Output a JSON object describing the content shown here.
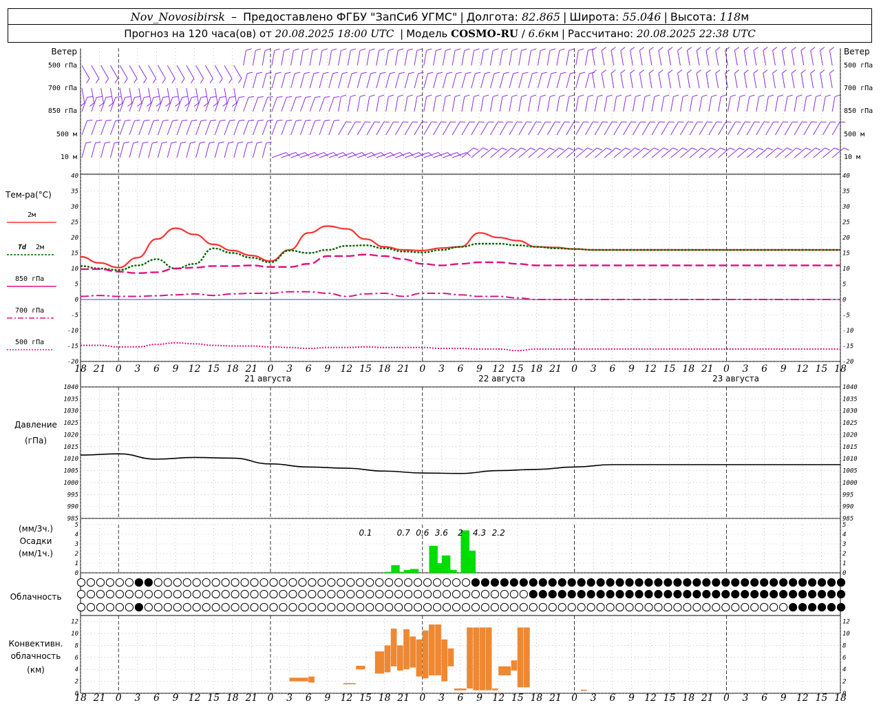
{
  "header": {
    "station": "Nov_Novosibirsk",
    "provider": "Предоставлено ФГБУ \"ЗапСиб УГМС\"",
    "lon_label": "Долгота:",
    "lon_value": "82.865",
    "lat_label": "Широта:",
    "lat_value": "55.046",
    "alt_label": "Высота:",
    "alt_value": "118",
    "alt_unit": "м",
    "forecast_pre": "Прогноз на 120 часа(ов) от",
    "forecast_time": "20.08.2025 18:00 UTC",
    "model_label": "Модель",
    "model_name": "COSMO-RU",
    "model_res": "6.6",
    "model_res_unit": "км",
    "calc_label": "Рассчитано:",
    "calc_time": "20.08.2025 22:38 UTC"
  },
  "labels": {
    "wind": "Ветер",
    "wind_levels": [
      "500 гПа",
      "700 гПа",
      "850 гПа",
      "500 м",
      "10 м"
    ],
    "temp_title": "Тем-ра(°C)",
    "temp_2m": "2м",
    "td": "Td",
    "td_2m": "2м",
    "t850": "850 гПа",
    "t700": "700 гПа",
    "t500": "500 гПа",
    "pressure1": "Давление",
    "pressure2": "(гПа)",
    "precip1": "(мм/3ч.)",
    "precip2": "Осадки",
    "precip3": "(мм/1ч.)",
    "cloud": "Облачность",
    "conv1": "Конвективн.",
    "conv2": "облачность",
    "conv3": "(км)",
    "dates": [
      "21 августа",
      "22 августа",
      "23 августа"
    ]
  },
  "colors": {
    "wind": "#8a2be2",
    "t2m": "#ff3030",
    "td": "#006400",
    "levels": "#e0117f",
    "zero": "#0000cc",
    "pressure": "#000000",
    "precip": "#00dd00",
    "conv": "#ee8833"
  },
  "chart_data": [
    {
      "type": "line",
      "name": "temperature",
      "x_hours": [
        0,
        3,
        6,
        9,
        12,
        15,
        18,
        21,
        24,
        27,
        30,
        33,
        36,
        39,
        42,
        45,
        48,
        51,
        54,
        57,
        60,
        63,
        66,
        69,
        72,
        75,
        78,
        81,
        84,
        87,
        90,
        93,
        96,
        99,
        102,
        105,
        108,
        111,
        114,
        117,
        120
      ],
      "x_tick_labels": [
        "18",
        "21",
        "0",
        "3",
        "6",
        "9",
        "12",
        "15",
        "18",
        "21",
        "0",
        "3",
        "6",
        "9",
        "12",
        "15",
        "18",
        "21",
        "0",
        "3",
        "6",
        "9",
        "12",
        "15",
        "18",
        "21",
        "0",
        "3",
        "6",
        "9",
        "12",
        "15",
        "18",
        "21",
        "0",
        "3",
        "6",
        "9",
        "12",
        "15",
        "18",
        "21",
        "0"
      ],
      "ylim": [
        -20,
        40
      ],
      "y_ticks": [
        40,
        35,
        30,
        25,
        20,
        15,
        10,
        5,
        0,
        -5,
        -10,
        -15,
        -20
      ],
      "series": [
        {
          "name": "2м",
          "values": [
            13.8,
            11.8,
            10.3,
            13.5,
            19.5,
            23.0,
            21.0,
            17.8,
            15.8,
            14.2,
            12.4,
            16.0,
            21.5,
            23.7,
            22.8,
            19.5,
            17.0,
            16.0,
            15.8,
            16.6,
            17.0,
            21.5,
            20.0,
            19.0,
            17.0,
            16.8,
            16.3,
            16.0,
            16.0,
            16.0,
            16.0,
            16.0,
            16.0,
            16.0,
            16.0,
            16.0,
            16.0,
            16.0,
            16.0,
            16.0,
            16.0
          ]
        },
        {
          "name": "Td 2м",
          "values": [
            10.8,
            10.0,
            9.5,
            11.0,
            13.0,
            10.0,
            11.5,
            16.5,
            15.0,
            13.5,
            12.0,
            15.8,
            15.0,
            16.0,
            17.3,
            17.5,
            16.5,
            15.5,
            15.2,
            16.0,
            17.0,
            18.0,
            18.0,
            17.5,
            17.0,
            16.5,
            16.3,
            16.0,
            16.0,
            16.0,
            16.0,
            16.0,
            16.0,
            16.0,
            16.0,
            16.0,
            16.0,
            16.0,
            16.0,
            16.0,
            16.0
          ]
        },
        {
          "name": "850 гПа",
          "values": [
            9.8,
            9.8,
            9.0,
            8.5,
            8.8,
            10.0,
            10.3,
            10.8,
            10.8,
            11.0,
            10.5,
            10.5,
            11.5,
            14.0,
            14.0,
            14.5,
            14.0,
            13.0,
            11.5,
            11.0,
            11.5,
            12.0,
            12.0,
            11.5,
            11.0,
            11.0,
            11.0,
            11.0,
            11.0,
            11.0,
            11.0,
            11.0,
            11.0,
            11.0,
            11.0,
            11.0,
            11.0,
            11.0,
            11.0,
            11.0,
            11.0
          ]
        },
        {
          "name": "700 гПа",
          "values": [
            1.0,
            1.3,
            1.0,
            1.0,
            1.2,
            1.5,
            1.8,
            1.3,
            1.8,
            2.0,
            2.0,
            2.5,
            2.5,
            2.0,
            1.0,
            1.8,
            2.0,
            1.0,
            2.0,
            2.0,
            1.5,
            1.0,
            1.0,
            0.5,
            0.0,
            0.0,
            0.0,
            0.0,
            0.0,
            0.0,
            0.0,
            0.0,
            0.0,
            0.0,
            0.0,
            0.0,
            0.0,
            0.0,
            0.0,
            0.0,
            0.0
          ]
        },
        {
          "name": "500 гПа",
          "values": [
            -14.8,
            -14.8,
            -15.3,
            -15.3,
            -14.5,
            -14.0,
            -14.3,
            -14.8,
            -15.0,
            -15.0,
            -15.3,
            -15.5,
            -15.8,
            -15.5,
            -15.5,
            -15.3,
            -15.5,
            -15.5,
            -15.5,
            -15.8,
            -15.8,
            -16.0,
            -16.0,
            -16.5,
            -16.0,
            -16.0,
            -16.0,
            -16.0,
            -16.0,
            -16.0,
            -16.0,
            -16.0,
            -16.0,
            -16.0,
            -16.0,
            -16.0,
            -16.0,
            -16.0,
            -16.0,
            -16.0,
            -16.0
          ]
        }
      ]
    },
    {
      "type": "line",
      "name": "pressure",
      "x_hours": [
        0,
        6,
        12,
        18,
        24,
        30,
        36,
        42,
        48,
        54,
        60,
        66,
        72,
        78,
        84,
        90,
        96,
        102,
        108,
        114,
        120
      ],
      "ylim": [
        985,
        1040
      ],
      "y_ticks": [
        1040,
        1035,
        1030,
        1025,
        1020,
        1015,
        1010,
        1005,
        1000,
        995,
        990,
        985
      ],
      "series": [
        {
          "name": "pressure",
          "values": [
            1011.5,
            1012.0,
            1009.8,
            1010.5,
            1010.2,
            1007.8,
            1006.5,
            1006.0,
            1004.8,
            1004.0,
            1003.8,
            1005.0,
            1005.5,
            1006.5,
            1007.5,
            1007.5,
            1007.5,
            1007.5,
            1007.5,
            1007.5,
            1007.5
          ]
        }
      ]
    },
    {
      "type": "bar",
      "name": "precipitation",
      "ylim": [
        0,
        5
      ],
      "y_ticks": [
        5,
        4,
        3,
        2,
        1,
        0
      ],
      "x_hours": [
        48,
        49,
        50,
        51,
        52,
        53,
        54,
        55,
        56,
        57,
        58,
        59,
        60,
        61,
        62
      ],
      "values": [
        0.1,
        0.8,
        0.1,
        0.3,
        0.4,
        0,
        0,
        2.8,
        1.0,
        1.8,
        0.3,
        0,
        4.4,
        2.3,
        0
      ],
      "labels_3h": [
        {
          "hour": 45,
          "text": "0.1"
        },
        {
          "hour": 51,
          "text": "0.7"
        },
        {
          "hour": 54,
          "text": "0.6"
        },
        {
          "hour": 57,
          "text": "3.6"
        },
        {
          "hour": 60,
          "text": "2"
        },
        {
          "hour": 63,
          "text": "4.3"
        },
        {
          "hour": 66,
          "text": "2.2"
        }
      ]
    },
    {
      "type": "bar",
      "name": "convective_cloud",
      "ylim": [
        0,
        13
      ],
      "y_ticks": [
        12,
        10,
        8,
        6,
        4,
        2,
        0
      ],
      "items": [
        {
          "h0": 33,
          "h1": 36,
          "b": 2.0,
          "t": 2.6
        },
        {
          "h0": 36,
          "h1": 37,
          "b": 1.8,
          "t": 2.8
        },
        {
          "h0": 41.5,
          "h1": 43.5,
          "b": 1.5,
          "t": 1.7
        },
        {
          "h0": 43.5,
          "h1": 45,
          "b": 4.0,
          "t": 4.6
        },
        {
          "h0": 46.5,
          "h1": 48,
          "b": 3.3,
          "t": 7.0
        },
        {
          "h0": 48,
          "h1": 49,
          "b": 3.5,
          "t": 8.0
        },
        {
          "h0": 49,
          "h1": 50,
          "b": 4.5,
          "t": 10.8
        },
        {
          "h0": 50,
          "h1": 51,
          "b": 3.8,
          "t": 8.0
        },
        {
          "h0": 51,
          "h1": 52,
          "b": 4.0,
          "t": 10.7
        },
        {
          "h0": 52,
          "h1": 53,
          "b": 4.3,
          "t": 9.5
        },
        {
          "h0": 53,
          "h1": 54,
          "b": 2.8,
          "t": 9.0
        },
        {
          "h0": 54,
          "h1": 55,
          "b": 2.5,
          "t": 10.5
        },
        {
          "h0": 55,
          "h1": 56,
          "b": 3.0,
          "t": 11.5
        },
        {
          "h0": 56,
          "h1": 57,
          "b": 3.0,
          "t": 11.5
        },
        {
          "h0": 57,
          "h1": 58,
          "b": 2.0,
          "t": 9.0
        },
        {
          "h0": 58,
          "h1": 59,
          "b": 4.5,
          "t": 7.5
        },
        {
          "h0": 59,
          "h1": 61,
          "b": 0.5,
          "t": 0.8
        },
        {
          "h0": 61,
          "h1": 62,
          "b": 0.8,
          "t": 11.0
        },
        {
          "h0": 62,
          "h1": 63,
          "b": 0.5,
          "t": 11.0
        },
        {
          "h0": 63,
          "h1": 64,
          "b": 0.5,
          "t": 11.0
        },
        {
          "h0": 64,
          "h1": 65,
          "b": 0.5,
          "t": 11.0
        },
        {
          "h0": 65,
          "h1": 66,
          "b": 0.5,
          "t": 0.8
        },
        {
          "h0": 66,
          "h1": 68,
          "b": 3.0,
          "t": 4.5
        },
        {
          "h0": 68,
          "h1": 69,
          "b": 3.8,
          "t": 5.5
        },
        {
          "h0": 69,
          "h1": 70,
          "b": 1.0,
          "t": 11.0
        },
        {
          "h0": 70,
          "h1": 71,
          "b": 1.0,
          "t": 11.0
        },
        {
          "h0": 79,
          "h1": 80,
          "b": 0.4,
          "t": 0.6
        }
      ]
    },
    {
      "type": "table",
      "name": "cloudiness",
      "rows": [
        "00000011000000000000000000000000000000000111111111111111111111111111111111111111",
        "00000000000000000000000000000000000000000000000111111111111111111111111111111111",
        "00000010000000000000000000000000000000000000000000000000000000000000000000111111"
      ]
    }
  ]
}
